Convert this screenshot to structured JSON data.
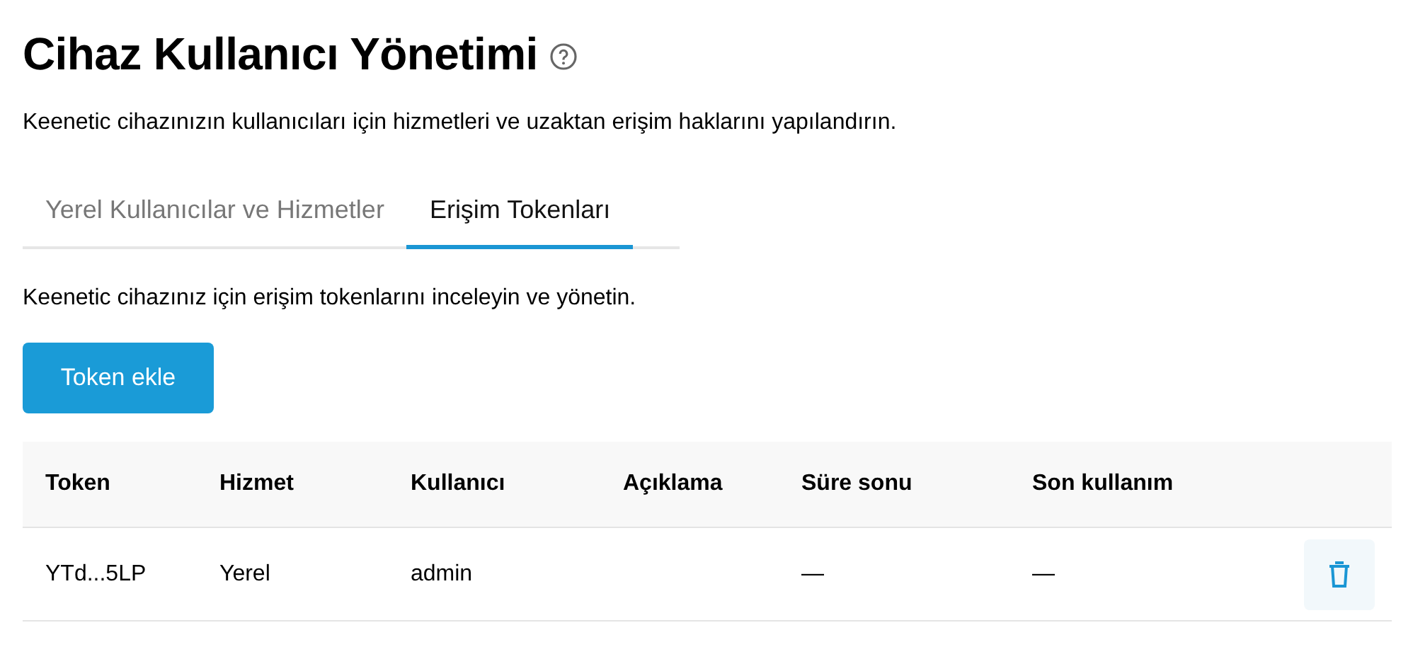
{
  "page": {
    "title": "Cihaz Kullanıcı Yönetimi",
    "description": "Keenetic cihazınızın kullanıcıları için hizmetleri ve uzaktan erişim haklarını yapılandırın."
  },
  "tabs": [
    {
      "label": "Yerel Kullanıcılar ve Hizmetler",
      "selected": false
    },
    {
      "label": "Erişim Tokenları",
      "selected": true
    }
  ],
  "section": {
    "description": "Keenetic cihazınız için erişim tokenlarını inceleyin ve yönetin.",
    "add_button": "Token ekle"
  },
  "table": {
    "columns": [
      "Token",
      "Hizmet",
      "Kullanıcı",
      "Açıklama",
      "Süre sonu",
      "Son kullanım"
    ],
    "rows": [
      {
        "cells": [
          "YTd...5LP",
          "Yerel",
          "admin",
          "",
          "—",
          "—"
        ]
      }
    ]
  }
}
